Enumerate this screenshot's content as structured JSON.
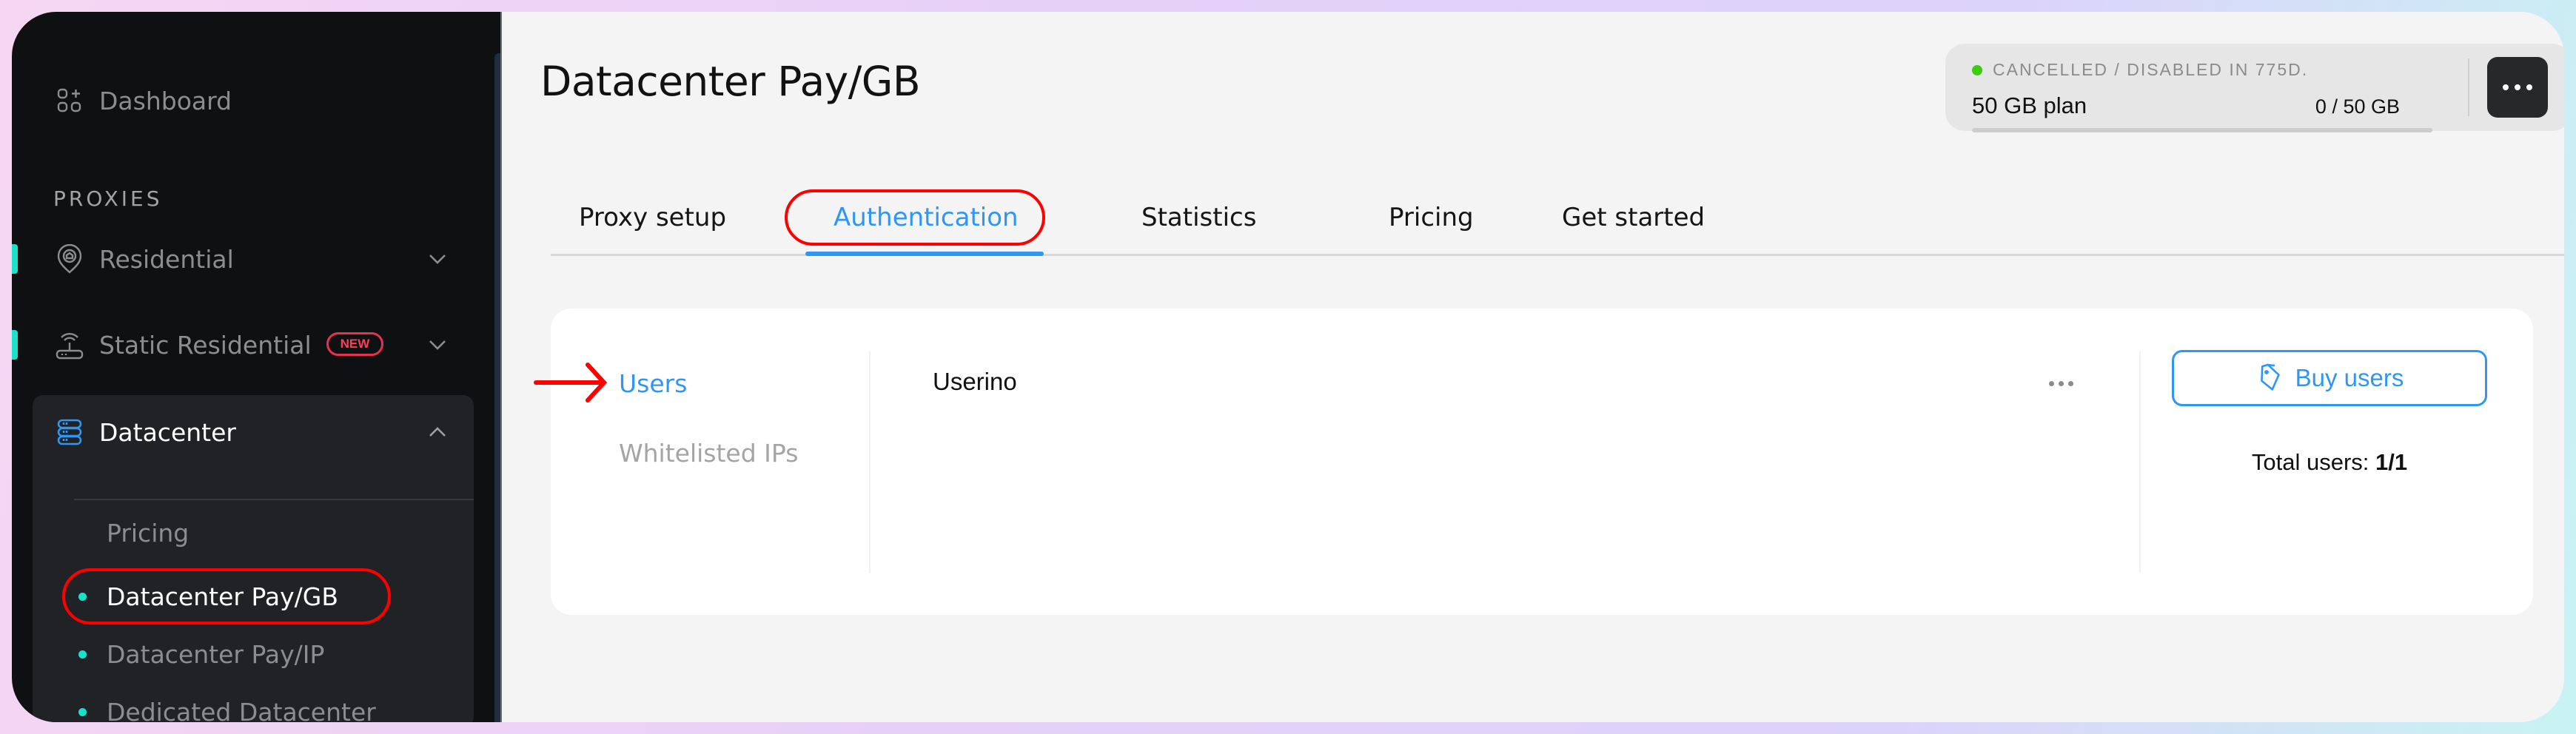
{
  "sidebar": {
    "dashboard_label": "Dashboard",
    "section_label": "PROXIES",
    "items": [
      {
        "label": "Residential",
        "icon": "location-home-icon",
        "expanded": false
      },
      {
        "label": "Static Residential",
        "icon": "router-icon",
        "badge": "NEW",
        "expanded": false
      },
      {
        "label": "Datacenter",
        "icon": "server-icon",
        "expanded": true
      }
    ],
    "datacenter_children": [
      {
        "label": "Pricing",
        "dot": false
      },
      {
        "label": "Datacenter Pay/GB",
        "dot": true,
        "active": true
      },
      {
        "label": "Datacenter Pay/IP",
        "dot": true
      },
      {
        "label": "Dedicated Datacenter",
        "dot": true
      }
    ]
  },
  "header": {
    "title": "Datacenter Pay/GB",
    "plan": {
      "status": "CANCELLED / DISABLED IN 775D.",
      "status_color": "#3dcb13",
      "name": "50 GB plan",
      "usage": "0 / 50 GB",
      "usage_used_gb": 0,
      "usage_total_gb": 50,
      "menu_icon": "more-horizontal-icon"
    }
  },
  "tabs": [
    {
      "label": "Proxy setup"
    },
    {
      "label": "Authentication",
      "active": true
    },
    {
      "label": "Statistics"
    },
    {
      "label": "Pricing"
    },
    {
      "label": "Get started"
    }
  ],
  "auth": {
    "nav": [
      {
        "label": "Users",
        "active": true
      },
      {
        "label": "Whitelisted IPs",
        "active": false
      }
    ],
    "users": [
      {
        "name": "Userino"
      }
    ],
    "buy_button_label": "Buy users",
    "total_users_label": "Total users:",
    "total_users_value": "1/1"
  },
  "colors": {
    "accent": "#2f96f4",
    "annotation": "#ff0000",
    "sidebar_bg": "#0f1012",
    "teal": "#17e3cb",
    "new_badge": "#ff3d58"
  }
}
